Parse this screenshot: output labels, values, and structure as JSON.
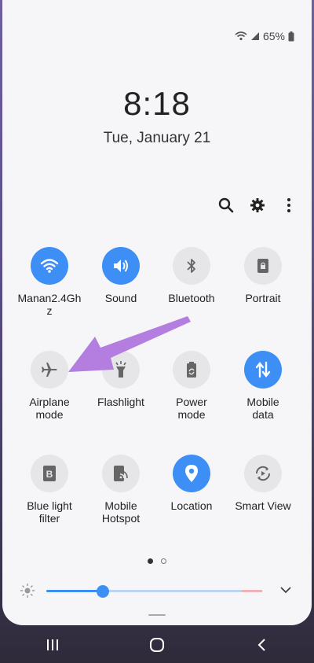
{
  "status": {
    "battery": "65%"
  },
  "clock": {
    "time": "8:18",
    "date": "Tue, January 21"
  },
  "actions": {
    "search_icon": "search-icon",
    "settings_icon": "gear-icon",
    "more_icon": "more-vertical-icon"
  },
  "tiles": [
    {
      "label": "Manan2.4Gh\nz",
      "icon": "wifi-icon",
      "on": true
    },
    {
      "label": "Sound",
      "icon": "volume-icon",
      "on": true
    },
    {
      "label": "Bluetooth",
      "icon": "bluetooth-icon",
      "on": false
    },
    {
      "label": "Portrait",
      "icon": "portrait-lock-icon",
      "on": false
    },
    {
      "label": "Airplane\nmode",
      "icon": "airplane-icon",
      "on": false
    },
    {
      "label": "Flashlight",
      "icon": "flashlight-icon",
      "on": false
    },
    {
      "label": "Power\nmode",
      "icon": "battery-icon",
      "on": false
    },
    {
      "label": "Mobile\ndata",
      "icon": "mobile-data-icon",
      "on": true
    },
    {
      "label": "Blue light\nfilter",
      "icon": "blue-light-icon",
      "on": false
    },
    {
      "label": "Mobile\nHotspot",
      "icon": "hotspot-icon",
      "on": false
    },
    {
      "label": "Location",
      "icon": "location-icon",
      "on": true
    },
    {
      "label": "Smart View",
      "icon": "smart-view-icon",
      "on": false
    }
  ],
  "brightness": {
    "level": 0.26
  },
  "colors": {
    "accent": "#3d8ef5",
    "arrow": "#b37ee0"
  }
}
